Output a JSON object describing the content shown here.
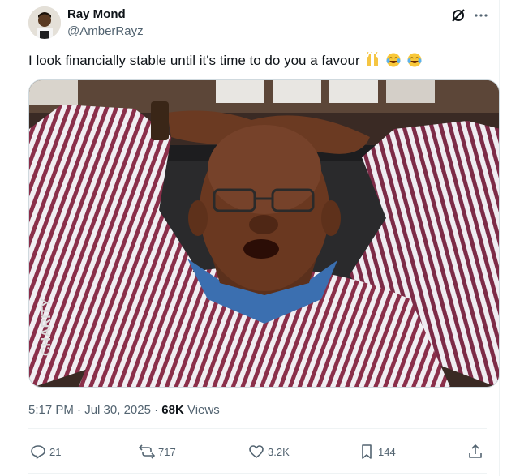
{
  "tweet": {
    "display_name": "Ray Mond",
    "handle": "@AmberRayz",
    "text": "I look financially stable until it's time to do you a favour",
    "emojis": [
      "raising-hands-emoji",
      "tears-of-joy-emoji",
      "tears-of-joy-emoji"
    ],
    "time": "5:17 PM",
    "separator": " · ",
    "date": "Jul 30, 2025",
    "views_count": "68K",
    "views_label": " Views",
    "image_watermark": "CHARITY"
  },
  "actions": {
    "replies": "21",
    "reposts": "717",
    "likes": "3.2K",
    "bookmarks": "144"
  },
  "icons": {
    "header": [
      "grok-icon",
      "more-icon"
    ],
    "actions": [
      "reply-icon",
      "repost-icon",
      "like-icon",
      "bookmark-icon",
      "share-icon"
    ]
  },
  "colors": {
    "text_primary": "#0f1419",
    "text_secondary": "#536471",
    "border": "#cfd9de"
  }
}
